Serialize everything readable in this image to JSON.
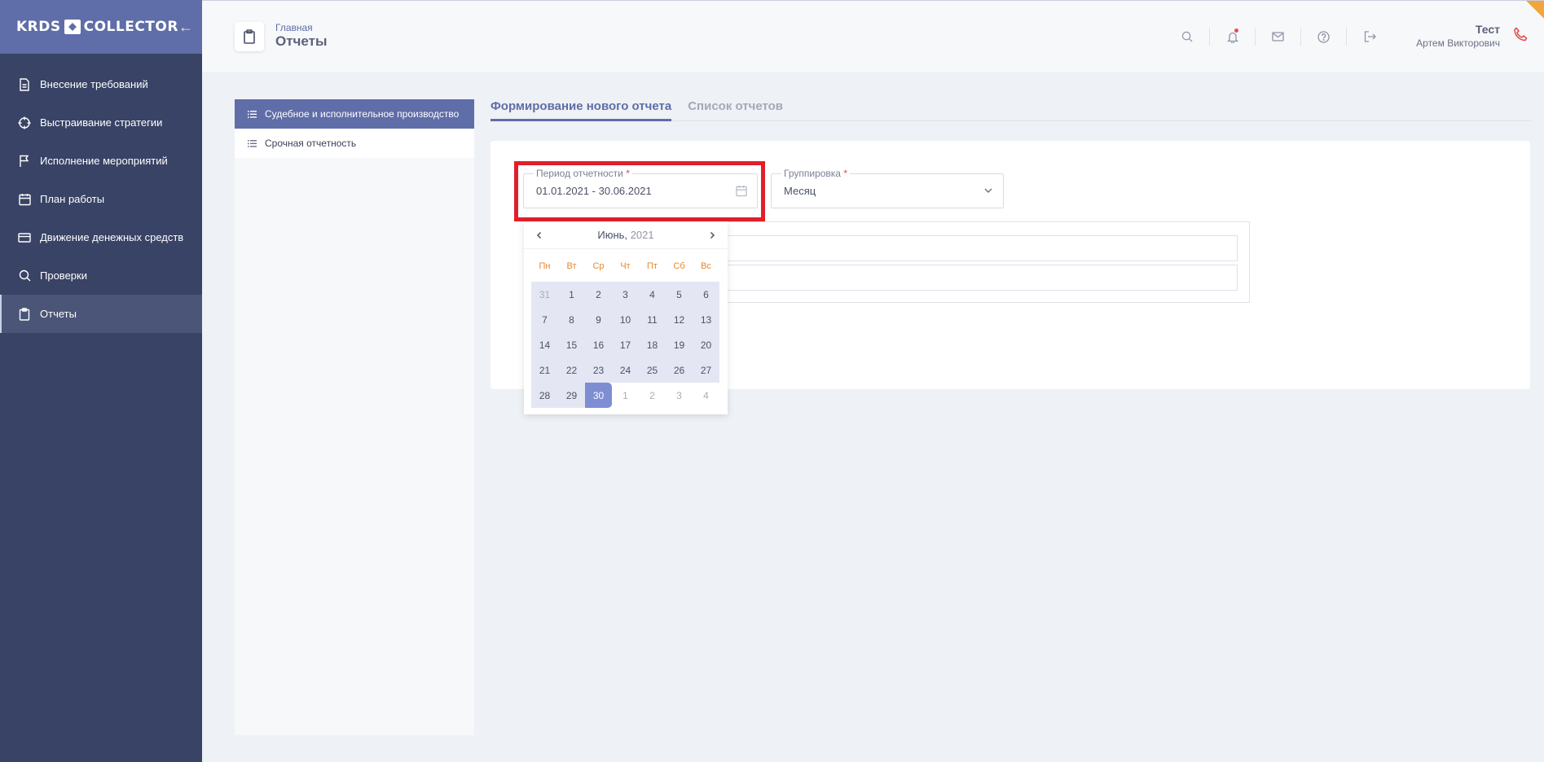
{
  "sidebar": {
    "logo_left": "KRDS",
    "logo_right": "COLLECTOR",
    "collapse": "←",
    "items": [
      {
        "label": "Внесение требований",
        "icon": "document-icon"
      },
      {
        "label": "Выстраивание стратегии",
        "icon": "target-icon"
      },
      {
        "label": "Исполнение мероприятий",
        "icon": "flag-icon"
      },
      {
        "label": "План работы",
        "icon": "calendar-icon"
      },
      {
        "label": "Движение денежных средств",
        "icon": "card-icon"
      },
      {
        "label": "Проверки",
        "icon": "search-icon"
      },
      {
        "label": "Отчеты",
        "icon": "clipboard-icon",
        "active": true
      }
    ]
  },
  "header": {
    "breadcrumb": "Главная",
    "title": "Отчеты",
    "user_short": "Тест",
    "user_full": "Артем Викторович"
  },
  "left_panel": {
    "items": [
      {
        "label": "Судебное и исполнительное производство",
        "active": true
      },
      {
        "label": "Срочная отчетность",
        "active": false
      }
    ]
  },
  "tabs": [
    {
      "label": "Формирование нового отчета",
      "active": true
    },
    {
      "label": "Список отчетов",
      "active": false
    }
  ],
  "form": {
    "period": {
      "label": "Период отчетности",
      "required": "*",
      "value": "01.01.2021 - 30.06.2021"
    },
    "grouping": {
      "label": "Группировка",
      "required": "*",
      "value": "Месяц"
    }
  },
  "calendar": {
    "month": "Июнь,",
    "year": "2021",
    "weekdays": [
      "Пн",
      "Вт",
      "Ср",
      "Чт",
      "Пт",
      "Сб",
      "Вс"
    ],
    "days": [
      {
        "d": "31",
        "s": "other-inrange"
      },
      {
        "d": "1",
        "s": "inrange"
      },
      {
        "d": "2",
        "s": "inrange"
      },
      {
        "d": "3",
        "s": "inrange"
      },
      {
        "d": "4",
        "s": "inrange"
      },
      {
        "d": "5",
        "s": "inrange"
      },
      {
        "d": "6",
        "s": "inrange"
      },
      {
        "d": "7",
        "s": "inrange"
      },
      {
        "d": "8",
        "s": "inrange"
      },
      {
        "d": "9",
        "s": "inrange"
      },
      {
        "d": "10",
        "s": "inrange"
      },
      {
        "d": "11",
        "s": "inrange"
      },
      {
        "d": "12",
        "s": "inrange"
      },
      {
        "d": "13",
        "s": "inrange"
      },
      {
        "d": "14",
        "s": "inrange"
      },
      {
        "d": "15",
        "s": "inrange"
      },
      {
        "d": "16",
        "s": "inrange"
      },
      {
        "d": "17",
        "s": "inrange"
      },
      {
        "d": "18",
        "s": "inrange"
      },
      {
        "d": "19",
        "s": "inrange"
      },
      {
        "d": "20",
        "s": "inrange"
      },
      {
        "d": "21",
        "s": "inrange"
      },
      {
        "d": "22",
        "s": "inrange"
      },
      {
        "d": "23",
        "s": "inrange"
      },
      {
        "d": "24",
        "s": "inrange"
      },
      {
        "d": "25",
        "s": "inrange"
      },
      {
        "d": "26",
        "s": "inrange"
      },
      {
        "d": "27",
        "s": "inrange"
      },
      {
        "d": "28",
        "s": "inrange"
      },
      {
        "d": "29",
        "s": "inrange"
      },
      {
        "d": "30",
        "s": "selected"
      },
      {
        "d": "1",
        "s": "other"
      },
      {
        "d": "2",
        "s": "other"
      },
      {
        "d": "3",
        "s": "other"
      },
      {
        "d": "4",
        "s": "other"
      }
    ]
  },
  "colors": {
    "sidebar_bg": "#384365",
    "accent": "#5f6da8",
    "highlight_red": "#e01f2a",
    "weekday_orange": "#e8852c"
  }
}
